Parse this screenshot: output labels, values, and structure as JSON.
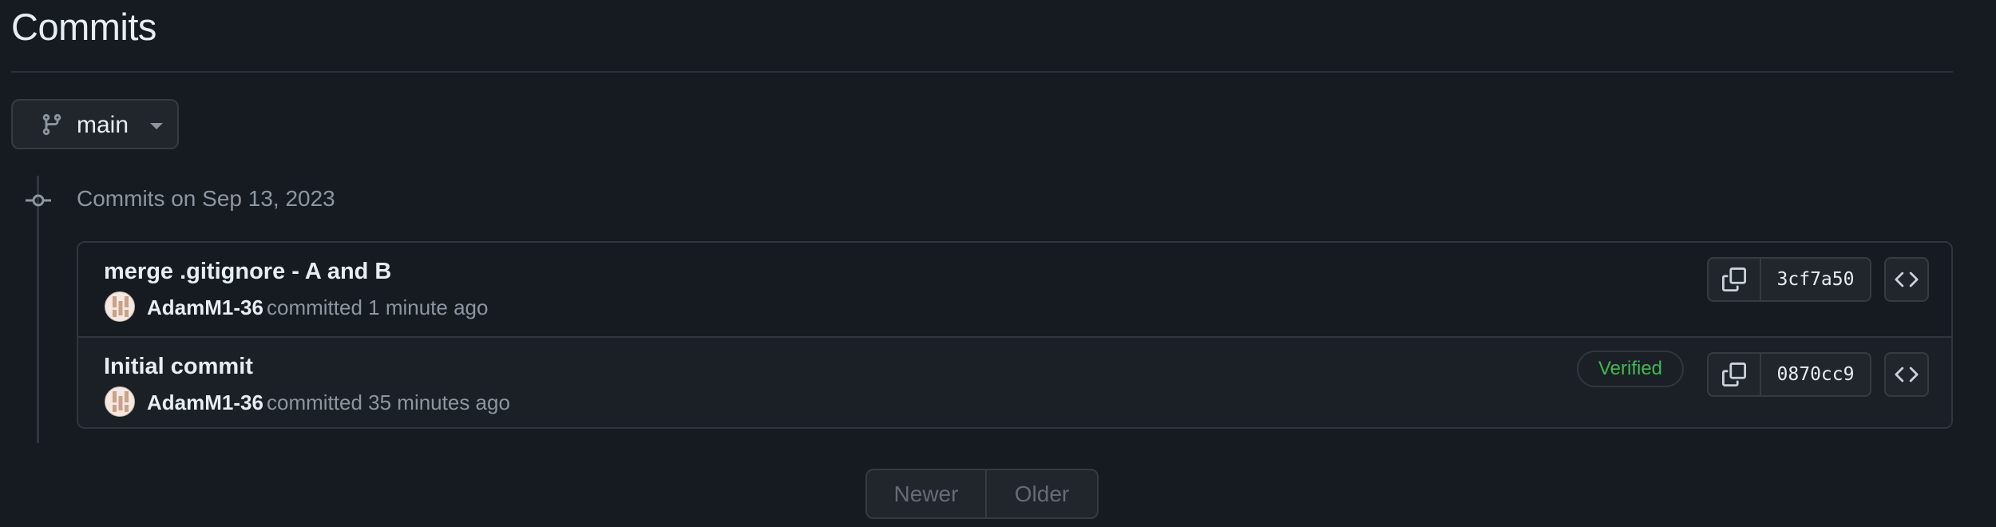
{
  "page": {
    "title": "Commits"
  },
  "branch": {
    "name": "main"
  },
  "group": {
    "date_label": "Commits on Sep 13, 2023"
  },
  "commits": [
    {
      "title": "merge .gitignore - A and B",
      "author": "AdamM1-36",
      "meta": "committed 1 minute ago",
      "sha": "3cf7a50",
      "verified": ""
    },
    {
      "title": "Initial commit",
      "author": "AdamM1-36",
      "meta": "committed 35 minutes ago",
      "sha": "0870cc9",
      "verified": "Verified"
    }
  ],
  "pagination": {
    "newer": "Newer",
    "older": "Older"
  },
  "icons": {
    "branch": "git-branch-icon",
    "caret": "caret-down-icon",
    "node": "git-commit-icon",
    "copy": "copy-icon",
    "browse": "code-icon"
  },
  "colors": {
    "verified": "#3fb950",
    "background": "#161b22",
    "border": "#30363d"
  }
}
